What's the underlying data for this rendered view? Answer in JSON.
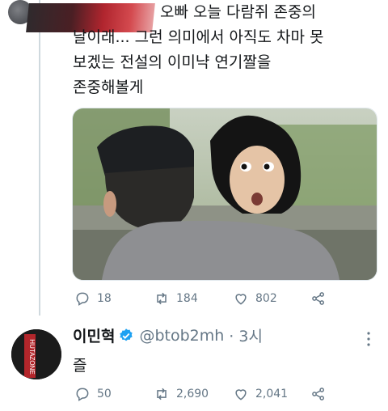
{
  "tweet1": {
    "text_first": "오빠 오늘 다람쥐 존중의",
    "text_rest": "날이래... 그런 의미에서 아직도 차마 못\n보겠는 전설의 이미냑 연기짤을\n존중해볼게",
    "replies": "18",
    "retweets": "184",
    "likes": "802"
  },
  "tweet2": {
    "name": "이민혁",
    "handle": "@btob2mh",
    "time": "· 3시",
    "text": "즐",
    "replies": "50",
    "retweets": "2,690",
    "likes": "2,041",
    "avatar_text": "HUTAZONE"
  },
  "colors": {
    "accent": "#1da1f2",
    "muted": "#657786",
    "text": "#14171a"
  }
}
